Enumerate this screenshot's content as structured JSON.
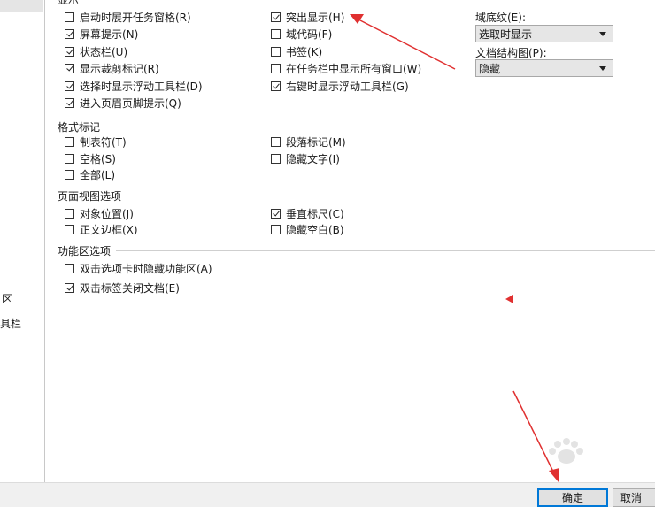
{
  "nav": {
    "items": [
      {
        "label": "区"
      },
      {
        "label": "具栏"
      }
    ]
  },
  "display": {
    "header": "显示",
    "left": [
      {
        "label": "启动时展开任务窗格(R)",
        "checked": false
      },
      {
        "label": "屏幕提示(N)",
        "checked": true
      },
      {
        "label": "状态栏(U)",
        "checked": true
      },
      {
        "label": "显示裁剪标记(R)",
        "checked": true
      },
      {
        "label": "选择时显示浮动工具栏(D)",
        "checked": true
      },
      {
        "label": "进入页眉页脚提示(Q)",
        "checked": true
      }
    ],
    "right": [
      {
        "label": "突出显示(H)",
        "checked": true
      },
      {
        "label": "域代码(F)",
        "checked": false
      },
      {
        "label": "书签(K)",
        "checked": false
      },
      {
        "label": "在任务栏中显示所有窗口(W)",
        "checked": false
      },
      {
        "label": "右键时显示浮动工具栏(G)",
        "checked": true
      }
    ],
    "field_shading": {
      "label": "域底纹(E):",
      "value": "选取时显示"
    },
    "doc_map": {
      "label": "文档结构图(P):",
      "value": "隐藏"
    }
  },
  "format_marks": {
    "header": "格式标记",
    "left": [
      {
        "label": "制表符(T)",
        "checked": false
      },
      {
        "label": "空格(S)",
        "checked": false
      },
      {
        "label": "全部(L)",
        "checked": false
      }
    ],
    "right": [
      {
        "label": "段落标记(M)",
        "checked": false
      },
      {
        "label": "隐藏文字(I)",
        "checked": false
      }
    ]
  },
  "page_view": {
    "header": "页面视图选项",
    "left": [
      {
        "label": "对象位置(J)",
        "checked": false
      },
      {
        "label": "正文边框(X)",
        "checked": false
      }
    ],
    "right": [
      {
        "label": "垂直标尺(C)",
        "checked": true
      },
      {
        "label": "隐藏空白(B)",
        "checked": false
      }
    ]
  },
  "ribbon": {
    "header": "功能区选项",
    "items": [
      {
        "label": "双击选项卡时隐藏功能区(A)",
        "checked": false
      },
      {
        "label": "双击标签关闭文档(E)",
        "checked": true
      }
    ]
  },
  "buttons": {
    "ok": "确定",
    "cancel": "取消"
  },
  "colors": {
    "annotation_arrow": "#e03030",
    "ok_border": "#0078d7"
  }
}
